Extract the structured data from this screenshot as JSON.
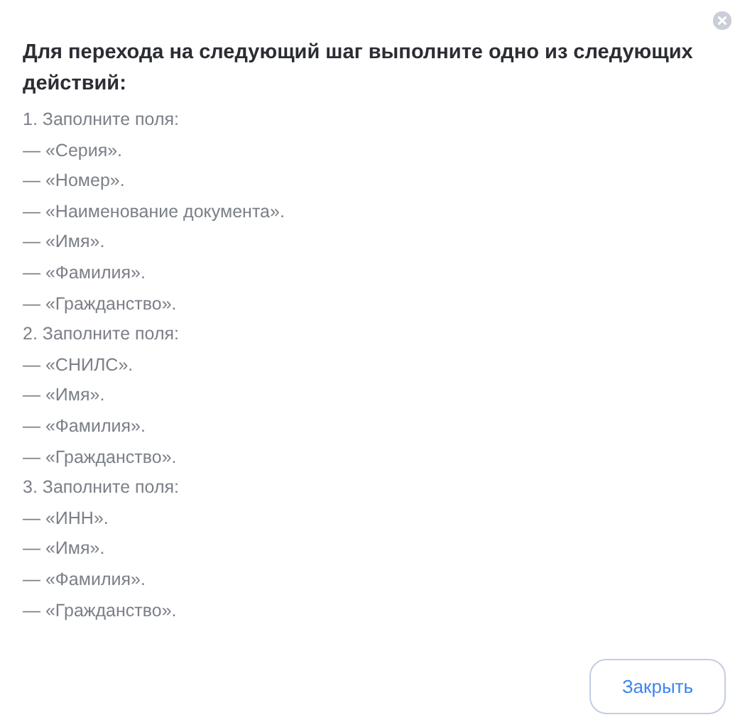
{
  "dialog": {
    "title": "Для перехода на следующий шаг выполните одно из следующих действий:",
    "lines": [
      "1. Заполните поля:",
      "— «Серия».",
      "— «Номер».",
      "— «Наименование документа».",
      "— «Имя».",
      "— «Фамилия».",
      "— «Гражданство».",
      "2. Заполните поля:",
      "— «СНИЛС».",
      "— «Имя».",
      "— «Фамилия».",
      "— «Гражданство».",
      "3. Заполните поля:",
      "— «ИНН».",
      "— «Имя».",
      "— «Фамилия».",
      "— «Гражданство»."
    ],
    "buttons": [
      "Закрыть"
    ]
  }
}
